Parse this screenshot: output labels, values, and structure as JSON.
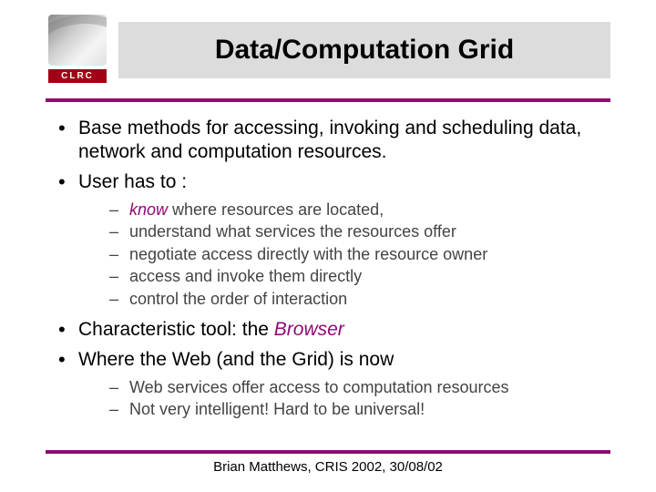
{
  "colors": {
    "accent": "#8f0b75",
    "titleBar": "#dcdcdc",
    "logoRed": "#a20016"
  },
  "logo": {
    "text": "CLRC"
  },
  "title": "Data/Computation Grid",
  "bullets": {
    "b1": "Base methods for accessing, invoking and scheduling data, network and computation resources.",
    "b2": "User has to :",
    "b2_sub": {
      "s1a": "know",
      "s1b": " where resources are located,",
      "s2": "understand what services the resources offer",
      "s3": "negotiate access directly with the resource owner",
      "s4": "access and invoke them directly",
      "s5": "control the order of interaction"
    },
    "b3a": "Characteristic tool: the ",
    "b3b": "Browser",
    "b4": "Where the Web (and the Grid) is now",
    "b4_sub": {
      "s1": "Web  services offer access to computation resources",
      "s2": "Not very intelligent!  Hard to be universal!"
    }
  },
  "footer": "Brian Matthews, CRIS 2002, 30/08/02"
}
